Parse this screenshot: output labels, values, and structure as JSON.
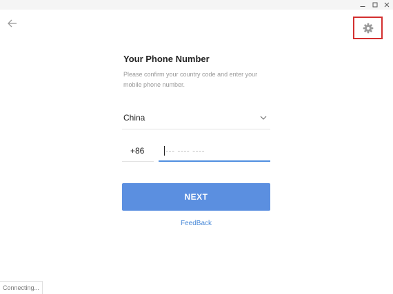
{
  "window": {
    "controls": [
      "minimize-icon",
      "maximize-icon",
      "close-icon"
    ]
  },
  "header": {
    "back_icon": "back-arrow-icon",
    "settings_icon": "gear-icon",
    "highlight_color": "#d32f2f"
  },
  "login": {
    "title": "Your Phone Number",
    "description": "Please confirm your country code and enter your mobile phone number.",
    "country": {
      "value": "China",
      "icon": "chevron-down-icon"
    },
    "country_code": "+86",
    "phone": {
      "value": "",
      "placeholder": "--- ---- ----"
    },
    "next_label": "NEXT",
    "feedback_label": "FeedBack",
    "accent_color": "#5b8fe0"
  },
  "status": {
    "text": "Connecting..."
  }
}
